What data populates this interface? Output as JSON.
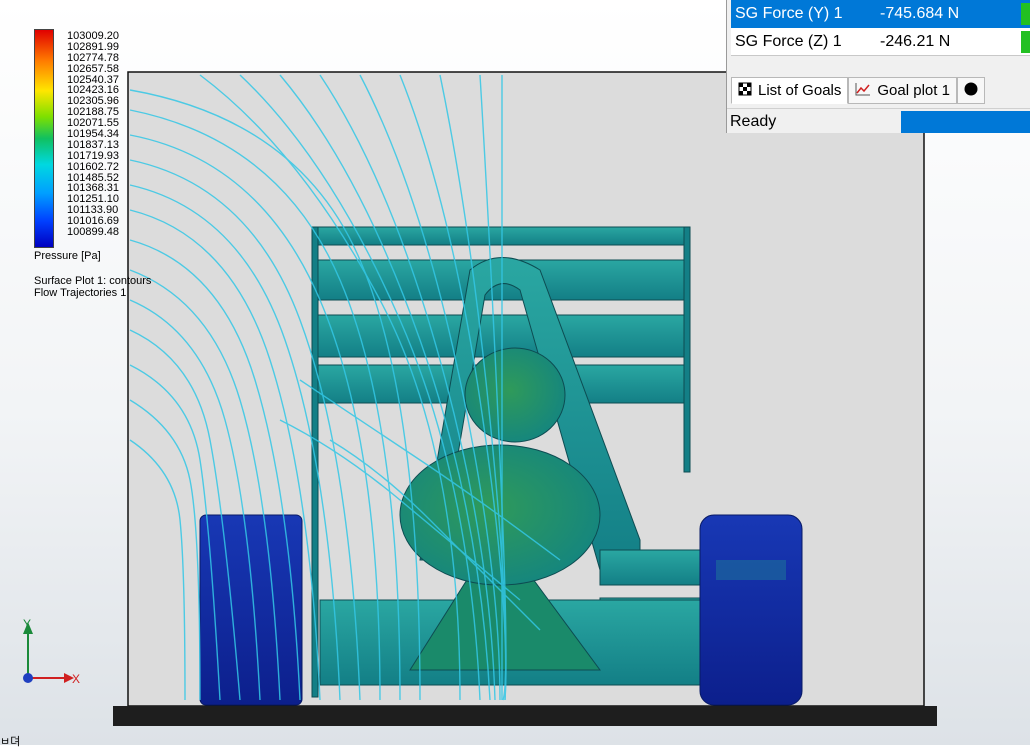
{
  "legend": {
    "ticks": [
      "103009.20",
      "102891.99",
      "102774.78",
      "102657.58",
      "102540.37",
      "102423.16",
      "102305.96",
      "102188.75",
      "102071.55",
      "101954.34",
      "101837.13",
      "101719.93",
      "101602.72",
      "101485.52",
      "101368.31",
      "101251.10",
      "101133.90",
      "101016.69",
      "100899.48"
    ],
    "title": "Pressure [Pa]",
    "plots": [
      "Surface Plot 1: contours",
      "Flow Trajectories 1"
    ]
  },
  "triad": {
    "y_label": "Y",
    "x_label": "X"
  },
  "goals_panel": {
    "rows": [
      {
        "name": "SG Force (Y) 1",
        "value": "-745.684 N",
        "selected": true
      },
      {
        "name": "SG Force (Z) 1",
        "value": "-246.21 N",
        "selected": false
      }
    ],
    "tabs": [
      "List of Goals",
      "Goal plot 1"
    ],
    "status": "Ready"
  },
  "colors": {
    "selection": "#0078d7",
    "flow": "#33c7e6",
    "model": "#1a8a9a",
    "ground": "#1e1e1e"
  },
  "corner_note": "ㅂ뎌"
}
